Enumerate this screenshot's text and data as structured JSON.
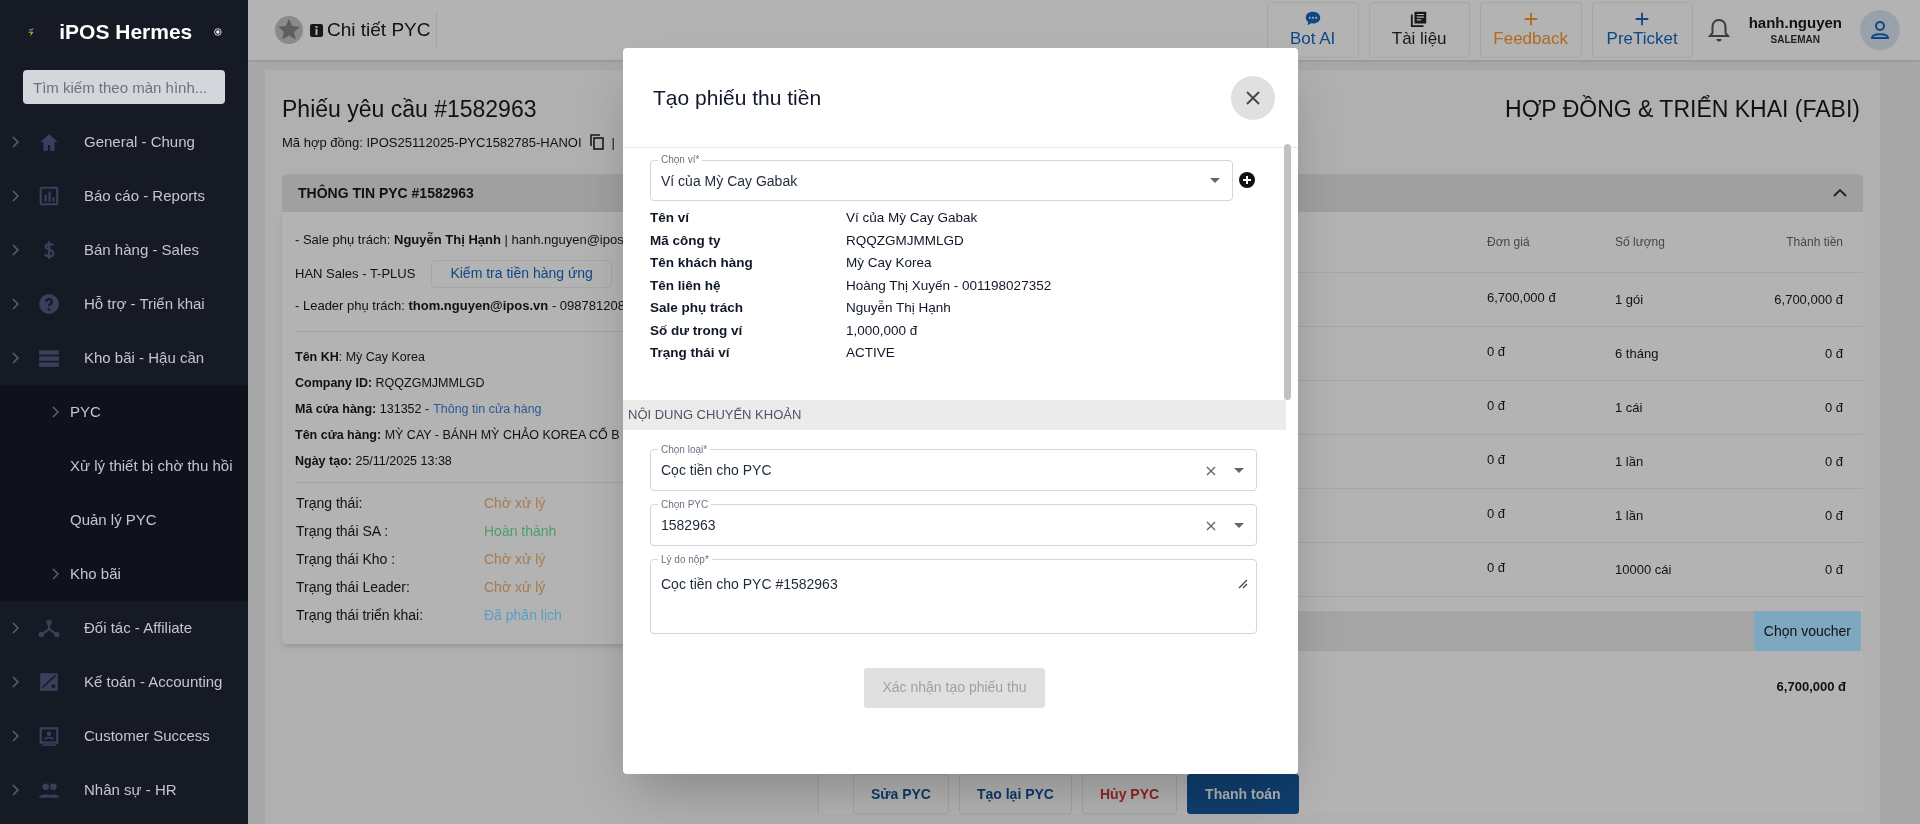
{
  "sidebar": {
    "title": "iPOS Hermes",
    "search": {
      "placeholder": "Tìm kiếm theo màn hình..."
    },
    "items": [
      {
        "label": "General - Chung",
        "expandable": true
      },
      {
        "label": "Báo cáo - Reports",
        "expandable": true
      },
      {
        "label": "Bán hàng - Sales",
        "expandable": true
      },
      {
        "label": "Hỗ trợ - Triển khai",
        "expandable": true
      },
      {
        "label": "Kho bãi - Hậu cần",
        "expandable": true,
        "children": [
          {
            "label": "PYC",
            "expandable": true
          },
          {
            "label": "Xử lý thiết bị chờ thu hồi",
            "expandable": false
          },
          {
            "label": "Quản lý PYC",
            "expandable": false
          },
          {
            "label": "Kho bãi",
            "expandable": true
          }
        ]
      },
      {
        "label": "Đối tác - Affiliate",
        "expandable": true
      },
      {
        "label": "Kế toán - Accounting",
        "expandable": true
      },
      {
        "label": "Customer Success",
        "expandable": true
      },
      {
        "label": "Nhân sự - HR",
        "expandable": true
      }
    ]
  },
  "header": {
    "title": "Chi tiết PYC",
    "buttons": [
      {
        "label": "Bot AI",
        "kind": "bot"
      },
      {
        "label": "Tài liệu",
        "kind": "docs"
      },
      {
        "label": "Feedback",
        "kind": "feedback"
      },
      {
        "label": "PreTicket",
        "kind": "ticket"
      }
    ],
    "user": {
      "name": "hanh.nguyen",
      "role": "SALEMAN"
    }
  },
  "page": {
    "title": "Phiếu yêu cầu #1582963",
    "contract": "Mã hợp đồng: IPOS25112025-PYC1582785-HANOI",
    "separator": "|",
    "section_title": "HỢP ĐỒNG & TRIỂN KHAI (FABI)"
  },
  "info_card": {
    "title": "THÔNG TIN PYC #1582963",
    "sale_line": "- Sale phụ trách: **Nguyễn Thị Hạnh** | hanh.nguyen@ipos",
    "team": "HAN Sales - T-PLUS",
    "check_button": "Kiểm tra tiền hàng ứng",
    "leader_line": "- Leader phụ trách: **thom.nguyen@ipos.vn** - 098781208",
    "fields": [
      {
        "text": "**Tên KH**: Mỳ Cay Korea"
      },
      {
        "text": "**Company ID:** RQQZGMJMMLGD"
      },
      {
        "text": "**Mã cửa hàng:** 131352 -",
        "link": "Thông tin cửa hàng"
      },
      {
        "text": "**Tên cửa hàng:** MỲ CAY - BÁNH MỲ CHẢO KOREA CỔ B"
      },
      {
        "text": "**Ngày tạo:** 25/11/2025 13:38"
      }
    ],
    "statuses": [
      {
        "label": "Trạng thái:",
        "value": "Chờ xử lý",
        "color": "#a87a50"
      },
      {
        "label": "Trạng thái SA :",
        "value": "Hoàn thành",
        "color": "#4e9e6a"
      },
      {
        "label": "Trạng thái Kho :",
        "value": "Chờ xử lý",
        "color": "#a87a50"
      },
      {
        "label": "Trạng thái Leader:",
        "value": "Chờ xử lý",
        "color": "#a87a50"
      },
      {
        "label": "Trạng thái triển khai:",
        "value": "Đã phân lịch",
        "color": "#5a9ec0"
      }
    ]
  },
  "items_table": {
    "columns": [
      "Đơn giá",
      "Số lượng",
      "Thành tiền"
    ],
    "rows": [
      {
        "unit_price": "6,700,000 đ",
        "quantity": "1 gói",
        "total": "6,700,000 đ"
      },
      {
        "unit_price": "0 đ",
        "quantity": "6 tháng",
        "total": "0 đ"
      },
      {
        "unit_price": "0 đ",
        "quantity": "1 cái",
        "total": "0 đ"
      },
      {
        "unit_price": "0 đ",
        "quantity": "1 lần",
        "total": "0 đ"
      },
      {
        "unit_price": "0 đ",
        "quantity": "1 lần",
        "total": "0 đ"
      },
      {
        "unit_price": "0 đ",
        "quantity": "10000 cái",
        "total": "0 đ"
      }
    ],
    "voucher_button": "Chọn voucher",
    "grand_total": "6,700,000 đ"
  },
  "actions": [
    {
      "label": "Sửa PYC",
      "kind": "outline"
    },
    {
      "label": "Tạo lại PYC",
      "kind": "outline"
    },
    {
      "label": "Hủy PYC",
      "kind": "danger"
    },
    {
      "label": "Thanh toán",
      "kind": "primary"
    }
  ],
  "modal": {
    "title": "Tạo phiếu thu tiền",
    "wallet_select": {
      "label": "Chọn ví*",
      "value": "Ví của Mỳ Cay Gabak"
    },
    "wallet_info": [
      {
        "label": "Tên ví",
        "value": "Ví của Mỳ Cay Gabak"
      },
      {
        "label": "Mã công ty",
        "value": "RQQZGMJMMLGD"
      },
      {
        "label": "Tên khách hàng",
        "value": "Mỳ Cay Korea"
      },
      {
        "label": "Tên liên hệ",
        "value": "Hoàng Thị Xuyến - 001198027352"
      },
      {
        "label": "Sale phụ trách",
        "value": "Nguyễn Thị Hạnh"
      },
      {
        "label": "Số dư trong ví",
        "value": "1,000,000 đ"
      },
      {
        "label": "Trạng thái ví",
        "value": "ACTIVE"
      }
    ],
    "section_title": "NỘI DUNG CHUYỂN KHOẢN",
    "type_select": {
      "label": "Chọn loại*",
      "value": "Cọc tiền cho PYC"
    },
    "pyc_select": {
      "label": "Chọn PYC",
      "value": "1582963"
    },
    "reason": {
      "label": "Lý do nộp*",
      "value": "Cọc tiền cho PYC #1582963"
    },
    "submit": {
      "label": "Xác nhận tạo phiếu thu",
      "disabled": true
    }
  }
}
